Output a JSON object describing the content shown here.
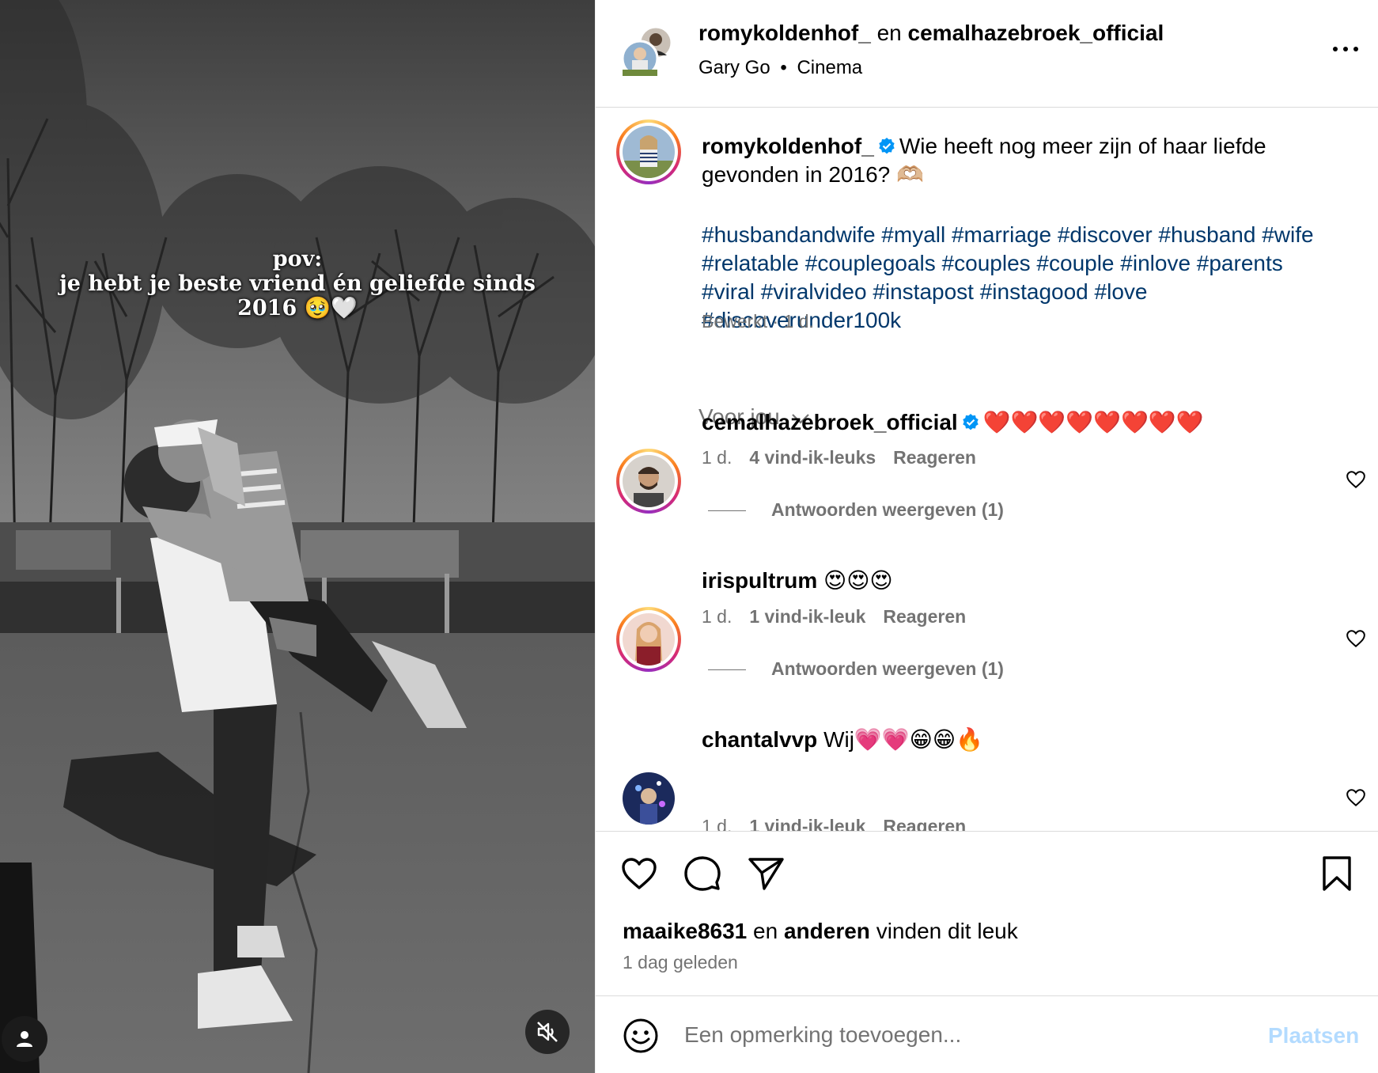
{
  "media": {
    "overlay_line1": "pov:",
    "overlay_line2": "je hebt je beste vriend én geliefde sinds",
    "overlay_line3": "2016 🥹🤍"
  },
  "header": {
    "author1": "romykoldenhof_",
    "joiner": "en",
    "author2": "cemalhazebroek_official",
    "music_artist": "Gary Go",
    "music_separator": "•",
    "music_track": "Cinema"
  },
  "caption": {
    "username": "romykoldenhof_",
    "text": "Wie heeft nog meer zijn of haar liefde gevonden in 2016? 🫶🏼",
    "hashtags": "#husbandandwife #myall #marriage #discover #husband #wife #relatable #couplegoals #couples #couple #inlove #parents #viral #viralvideo #instapost #instagood #love #discoverunder100k",
    "meta": "Bewerkt · 1 d."
  },
  "filter_label": "Voor jou",
  "comments": [
    {
      "username": "cemalhazebroek_official",
      "verified": true,
      "text": "❤️❤️❤️❤️❤️❤️❤️❤️",
      "age": "1 d.",
      "likes": "4 vind-ik-leuks",
      "reply": "Reageren",
      "view_replies": "Antwoorden weergeven (1)"
    },
    {
      "username": "irispultrum",
      "verified": false,
      "text": "😍😍😍",
      "age": "1 d.",
      "likes": "1 vind-ik-leuk",
      "reply": "Reageren",
      "view_replies": "Antwoorden weergeven (1)"
    },
    {
      "username": "chantalvvp",
      "verified": false,
      "text": "Wij💗💗😁😁🔥",
      "age": "1 d.",
      "likes": "1 vind-ik-leuk",
      "reply": "Reageren"
    }
  ],
  "footer": {
    "liked_by_user": "maaike8631",
    "liked_by_joiner": "en",
    "liked_by_others": "anderen",
    "liked_by_suffix": "vinden dit leuk",
    "date": "1 dag geleden",
    "comment_placeholder": "Een opmerking toevoegen...",
    "post_label": "Plaatsen"
  },
  "icons": {
    "like": "heart-icon",
    "comment": "comment-bubble-icon",
    "share": "paper-plane-icon",
    "save": "bookmark-icon",
    "emoji": "smiley-icon",
    "mute": "speaker-muted-icon",
    "tagged_user": "user-icon",
    "more": "more-options-icon",
    "verified": "verified-badge-icon"
  },
  "colors": {
    "link": "#00376b",
    "muted_text": "#737373",
    "verified": "#0095f6",
    "post_disabled": "#b3dbff"
  }
}
